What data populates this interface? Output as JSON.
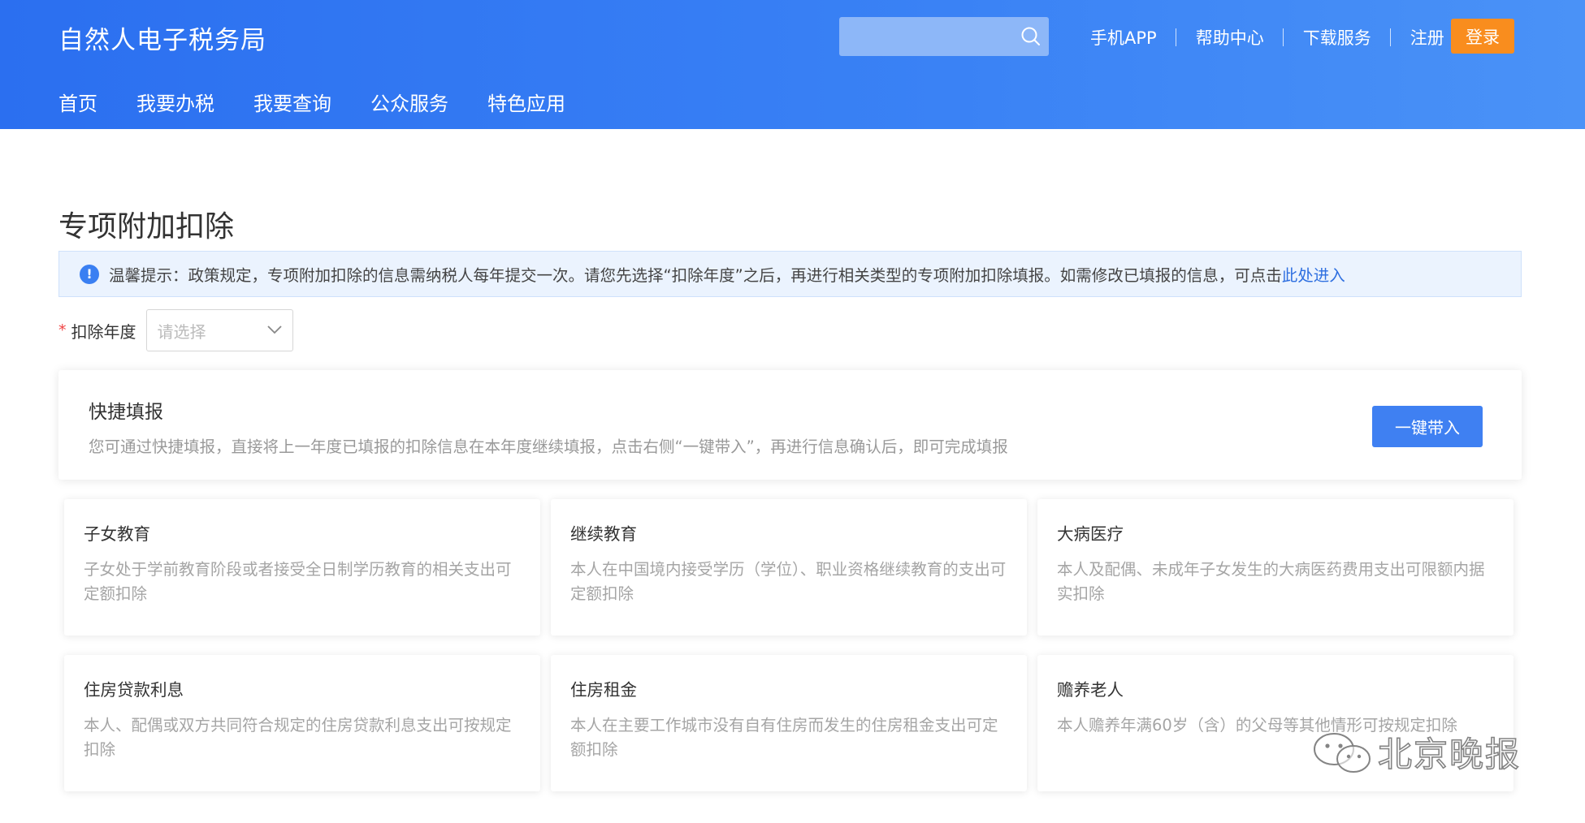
{
  "header": {
    "site_title": "自然人电子税务局",
    "search": {
      "placeholder": ""
    },
    "top_links": [
      "手机APP",
      "帮助中心",
      "下载服务",
      "注册"
    ],
    "login_label": "登录",
    "nav": [
      "首页",
      "我要办税",
      "我要查询",
      "公众服务",
      "特色应用"
    ]
  },
  "page": {
    "title": "专项附加扣除",
    "notice_text": "温馨提示：政策规定，专项附加扣除的信息需纳税人每年提交一次。请您先选择“扣除年度”之后，再进行相关类型的专项附加扣除填报。如需修改已填报的信息，可点击",
    "notice_link": "此处进入",
    "notice_icon": "info-icon",
    "year_field": {
      "required_mark": "*",
      "label": "扣除年度",
      "placeholder": "请选择"
    }
  },
  "quick_fill": {
    "title": "快捷填报",
    "description": "您可通过快捷填报，直接将上一年度已填报的扣除信息在本年度继续填报，点击右侧“一键带入”，再进行信息确认后，即可完成填报",
    "button_label": "一键带入"
  },
  "deductions": [
    {
      "title": "子女教育",
      "desc": "子女处于学前教育阶段或者接受全日制学历教育的相关支出可定额扣除"
    },
    {
      "title": "继续教育",
      "desc": "本人在中国境内接受学历（学位）、职业资格继续教育的支出可定额扣除"
    },
    {
      "title": "大病医疗",
      "desc": "本人及配偶、未成年子女发生的大病医药费用支出可限额内据实扣除"
    },
    {
      "title": "住房贷款利息",
      "desc": "本人、配偶或双方共同符合规定的住房贷款利息支出可按规定扣除"
    },
    {
      "title": "住房租金",
      "desc": "本人在主要工作城市没有自有住房而发生的住房租金支出可定额扣除"
    },
    {
      "title": "赡养老人",
      "desc": "本人赡养年满60岁（含）的父母等其他情形可按规定扣除"
    }
  ],
  "watermark": {
    "text": "北京晚报",
    "icon": "wechat-icon"
  },
  "colors": {
    "header_blue": "#2b6ff0",
    "login_orange": "#f98d1e",
    "accent_blue": "#3f80f2",
    "required_red": "#f04444"
  }
}
